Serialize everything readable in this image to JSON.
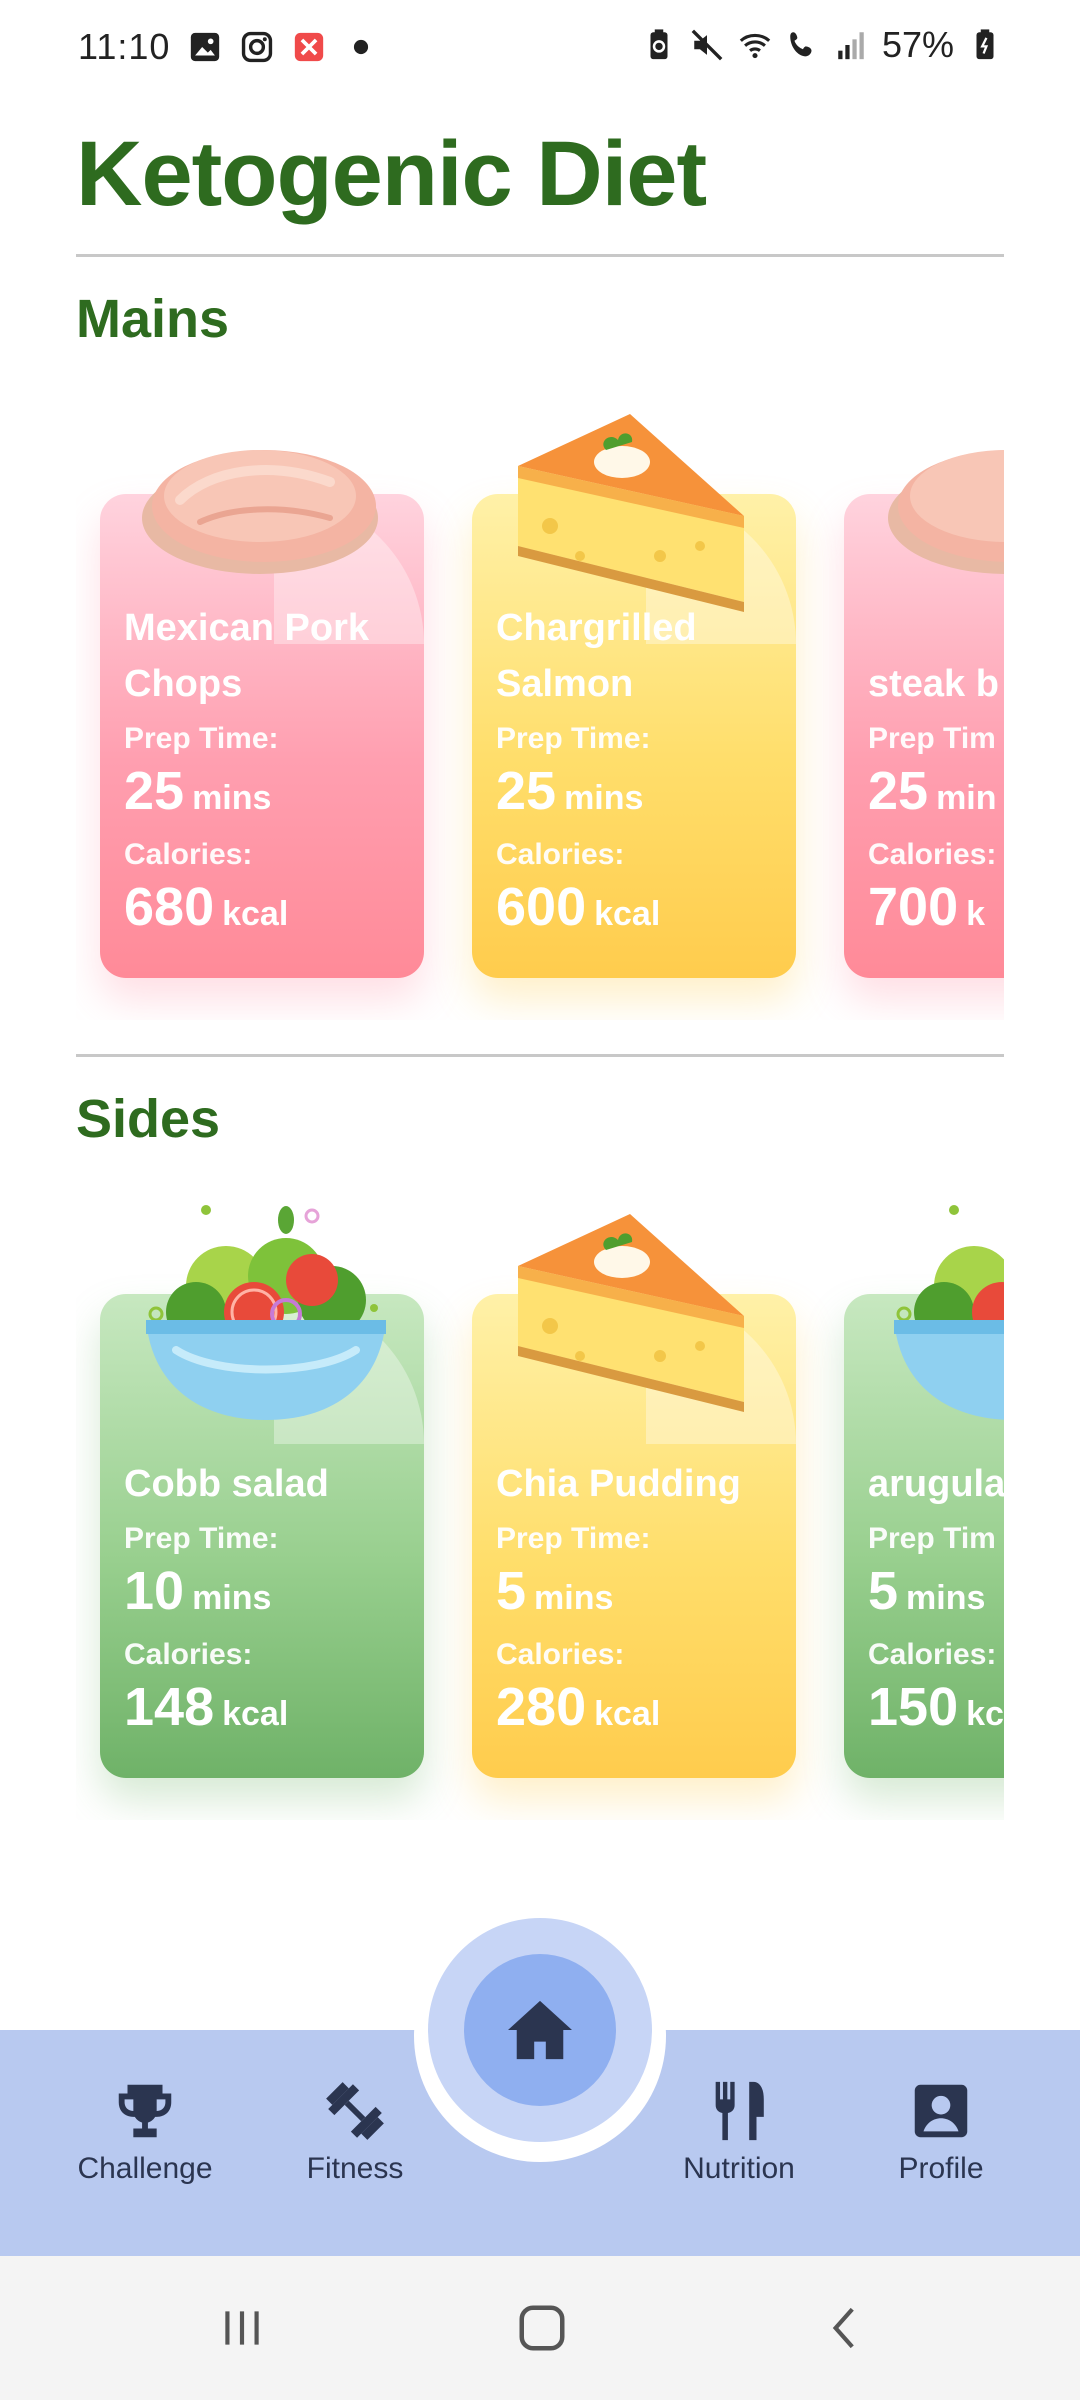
{
  "status_bar": {
    "time": "11:10",
    "battery_pct": "57%",
    "left_icons": [
      "gallery-icon",
      "instagram-icon",
      "notification-x-icon",
      "dot-icon"
    ],
    "right_icons": [
      "battery-saver-icon",
      "mute-icon",
      "wifi-icon",
      "wifi-call-icon",
      "signal-icon",
      "battery-icon"
    ]
  },
  "title": "Ketogenic Diet",
  "sections": [
    {
      "title": "Mains",
      "cards": [
        {
          "name": "Mexican Pork Chops",
          "prep_label": "Prep Time:",
          "prep_value": "25",
          "prep_unit": "mins",
          "cal_label": "Calories:",
          "cal_value": "680",
          "cal_unit": "kcal",
          "color": "#ff9aa8",
          "image": "chicken-breast"
        },
        {
          "name": "Chargrilled Salmon",
          "prep_label": "Prep Time:",
          "prep_value": "25",
          "prep_unit": "mins",
          "cal_label": "Calories:",
          "cal_value": "600",
          "cal_unit": "kcal",
          "color": "#ffd95a",
          "image": "cheesecake"
        },
        {
          "name": "steak b",
          "prep_label": "Prep Tim",
          "prep_value": "25",
          "prep_unit": "min",
          "cal_label": "Calories:",
          "cal_value": "700",
          "cal_unit": "k",
          "color": "#ff9aa8",
          "image": "chicken-breast"
        }
      ]
    },
    {
      "title": "Sides",
      "cards": [
        {
          "name": "Cobb salad",
          "prep_label": "Prep Time:",
          "prep_value": "10",
          "prep_unit": "mins",
          "cal_label": "Calories:",
          "cal_value": "148",
          "cal_unit": "kcal",
          "color": "#8cc884",
          "image": "salad-bowl"
        },
        {
          "name": "Chia Pudding",
          "prep_label": "Prep Time:",
          "prep_value": "5",
          "prep_unit": "mins",
          "cal_label": "Calories:",
          "cal_value": "280",
          "cal_unit": "kcal",
          "color": "#ffd95a",
          "image": "cheesecake"
        },
        {
          "name": "arugula",
          "prep_label": "Prep Tim",
          "prep_value": "5",
          "prep_unit": "mins",
          "cal_label": "Calories:",
          "cal_value": "150",
          "cal_unit": "kc",
          "color": "#8cc884",
          "image": "salad-bowl"
        }
      ]
    }
  ],
  "bottom_nav": {
    "items": [
      {
        "label": "Challenge",
        "icon": "trophy-icon"
      },
      {
        "label": "Fitness",
        "icon": "dumbbell-icon"
      },
      {
        "label": "Nutrition",
        "icon": "fork-knife-icon"
      },
      {
        "label": "Profile",
        "icon": "profile-icon"
      }
    ],
    "center": {
      "icon": "home-icon"
    }
  },
  "system_nav": [
    "recents-icon",
    "home-outline-icon",
    "back-icon"
  ]
}
